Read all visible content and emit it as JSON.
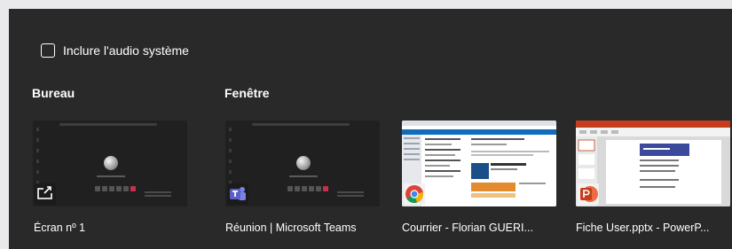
{
  "audio": {
    "label": "Inclure l'audio système",
    "checked": false
  },
  "sections": {
    "desktop_title": "Bureau",
    "window_title": "Fenêtre"
  },
  "sources": [
    {
      "label": "Écran nº 1",
      "icon": "share-screen-icon"
    },
    {
      "label": "Réunion | Microsoft Teams",
      "icon": "teams-icon"
    },
    {
      "label": "Courrier - Florian GUERI...",
      "icon": "chrome-icon"
    },
    {
      "label": "Fiche User.pptx - PowerP...",
      "icon": "powerpoint-icon"
    }
  ],
  "colors": {
    "panel": "#292929",
    "teams": "#5b5fc7",
    "powerpoint": "#c43e1c",
    "chrome_red": "#db4437",
    "chrome_yellow": "#f4b400",
    "chrome_green": "#0f9d58",
    "chrome_blue": "#4285f4"
  }
}
